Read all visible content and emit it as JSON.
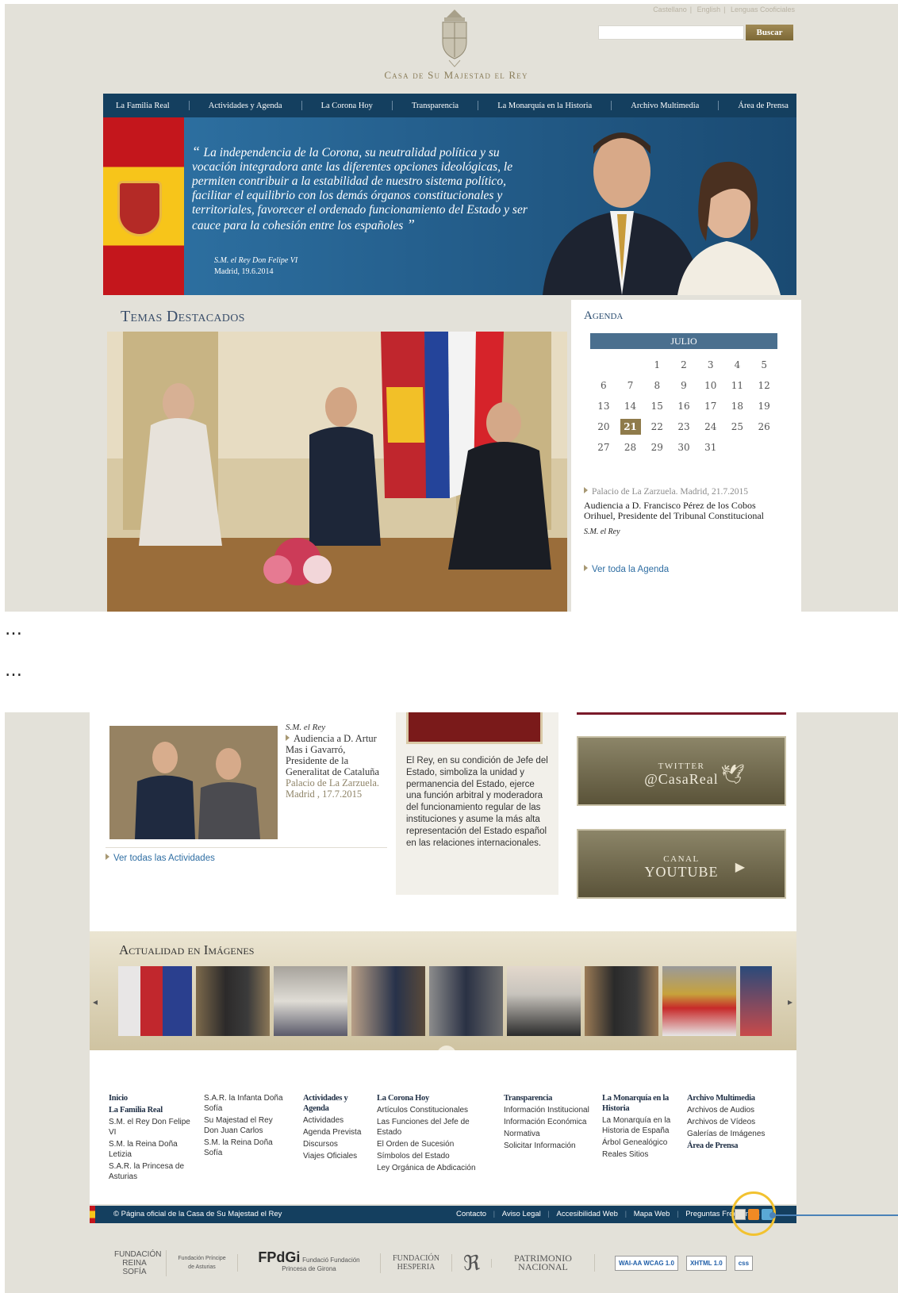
{
  "header": {
    "languages": [
      "Castellano",
      "English",
      "Lenguas Cooficiales"
    ],
    "search_placeholder": "",
    "search_button": "Buscar",
    "site_title": "Casa de Su Majestad el Rey"
  },
  "nav": {
    "items": [
      "La Familia Real",
      "Actividades y Agenda",
      "La Corona Hoy",
      "Transparencia",
      "La Monarquía en la Historia",
      "Archivo Multimedia",
      "Área de Prensa"
    ]
  },
  "hero": {
    "quote": "La independencia de la Corona, su neutralidad política y su vocación integradora ante las diferentes opciones ideológicas, le permiten contribuir a la estabilidad de nuestro sistema político, facilitar el equilibrio con los demás órganos constitucionales y territoriales, favorecer el ordenado funcionamiento del Estado y ser cauce para la cohesión entre los españoles",
    "author": "S.M. el Rey Don Felipe VI",
    "place_date": "Madrid, 19.6.2014"
  },
  "temas": {
    "title": "Temas Destacados"
  },
  "agenda": {
    "title": "Agenda",
    "month": "JULIO",
    "days": [
      "",
      "",
      "1",
      "2",
      "3",
      "4",
      "5",
      "6",
      "7",
      "8",
      "9",
      "10",
      "11",
      "12",
      "13",
      "14",
      "15",
      "16",
      "17",
      "18",
      "19",
      "20",
      "21",
      "22",
      "23",
      "24",
      "25",
      "26",
      "27",
      "28",
      "29",
      "30",
      "31",
      "",
      ""
    ],
    "today": "21",
    "event_place": "Palacio de La Zarzuela. Madrid, 21.7.2015",
    "event_title": "Audiencia a D. Francisco Pérez de los Cobos Orihuel, Presidente del Tribunal Constitucional",
    "event_who": "S.M. el Rey",
    "see_all": "Ver toda la Agenda"
  },
  "dots": "…",
  "actividades": {
    "who": "S.M. el Rey",
    "title": "Audiencia a D. Artur Mas i Gavarró, Presidente de la Generalitat de Cataluña",
    "place": "Palacio de La Zarzuela. Madrid , 17.7.2015",
    "see_all": "Ver todas las Actividades"
  },
  "corona": {
    "text": "El Rey, en su condición de Jefe del Estado, simboliza la unidad y permanencia del Estado, ejerce una función arbitral y moderadora del funcionamiento regular de las instituciones y asume la más alta representación del Estado español en las relaciones internacionales."
  },
  "social": {
    "twitter_l1": "TWITTER",
    "twitter_l2": "@CasaReal",
    "youtube_l1": "CANAL",
    "youtube_l2": "YOUTUBE"
  },
  "actualidad": {
    "title": "Actualidad en Imágenes"
  },
  "footer": {
    "col1": [
      "Inicio",
      "La Familia Real",
      "S.M. el Rey Don Felipe VI",
      "S.M. la Reina Doña Letizia",
      "S.A.R. la Princesa de Asturias"
    ],
    "col2": [
      "S.A.R. la Infanta Doña Sofía",
      "Su Majestad el Rey Don Juan Carlos",
      "S.M. la Reina Doña Sofía"
    ],
    "col3": [
      "Actividades y Agenda",
      "Actividades",
      "Agenda Prevista",
      "Discursos",
      "Viajes Oficiales"
    ],
    "col4": [
      "La Corona Hoy",
      "Artículos Constitucionales",
      "Las Funciones del Jefe de Estado",
      "El Orden de Sucesión",
      "Símbolos del Estado",
      "Ley Orgánica de Abdicación"
    ],
    "col5": [
      "Transparencia",
      "Información Institucional",
      "Información Económica",
      "Normativa",
      "Solicitar Información"
    ],
    "col6": [
      "La Monarquía en la Historia",
      "La Monarquía en la Historia de España",
      "Árbol Genealógico",
      "Reales Sitios"
    ],
    "col7": [
      "Archivo Multimedia",
      "Archivos de Audios",
      "Archivos de Vídeos",
      "Galerías de Imágenes",
      "Área de Prensa"
    ]
  },
  "bar": {
    "copy": "© Página oficial de la Casa de Su Majestad el Rey",
    "links": [
      "Contacto",
      "Aviso Legal",
      "Accesibilidad Web",
      "Mapa Web",
      "Preguntas Frecuentes"
    ]
  },
  "sponsors": {
    "s1": "FUNDACIÓN REINA SOFÍA",
    "s2": "Fundación Príncipe de Asturias",
    "s3_a": "FPdGi",
    "s3_b": "Fundació Fundación Princesa de Girona",
    "s4": "FUNDACIÓN HESPERIA",
    "s5": "PATRIMONIO NACIONAL",
    "w3c": [
      "WAI-AA WCAG 1.0",
      "XHTML 1.0",
      "css"
    ]
  },
  "colors": {
    "nav_bg": "#143f5f",
    "gold": "#8f7b4b",
    "link": "#2f6ea3",
    "highlight": "#f2c230"
  }
}
